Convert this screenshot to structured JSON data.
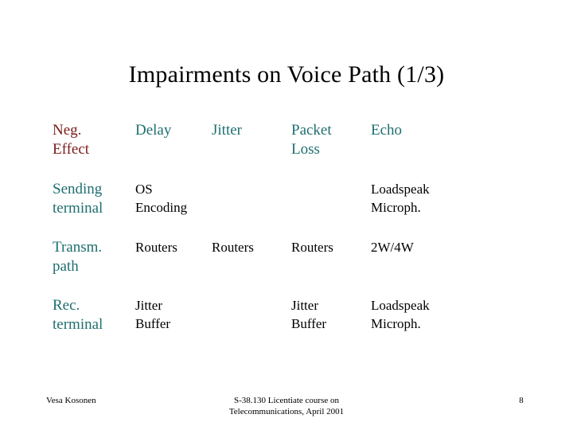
{
  "slide": {
    "title": "Impairments on Voice Path (1/3)",
    "colors": {
      "title": "#000000",
      "effect_label": "#7b1a1a",
      "metric_header": "#1f6f6f",
      "row_label": "#1f6f6f",
      "cell_text": "#000000",
      "background": "#ffffff"
    }
  },
  "table": {
    "headers": [
      {
        "line1": "Neg.",
        "line2": "Effect"
      },
      {
        "line1": "Delay",
        "line2": ""
      },
      {
        "line1": "Jitter",
        "line2": ""
      },
      {
        "line1": "Packet",
        "line2": "Loss"
      },
      {
        "line1": "Echo",
        "line2": ""
      }
    ],
    "rows": [
      {
        "label": {
          "line1": "Sending",
          "line2": "terminal"
        },
        "cells": [
          {
            "line1": "OS",
            "line2": "Encoding"
          },
          {
            "line1": "",
            "line2": ""
          },
          {
            "line1": "",
            "line2": ""
          },
          {
            "line1": "Loadspeak",
            "line2": "Microph."
          }
        ]
      },
      {
        "label": {
          "line1": "Transm.",
          "line2": "path"
        },
        "cells": [
          {
            "line1": "Routers",
            "line2": ""
          },
          {
            "line1": "Routers",
            "line2": ""
          },
          {
            "line1": "Routers",
            "line2": ""
          },
          {
            "line1": "2W/4W",
            "line2": ""
          }
        ]
      },
      {
        "label": {
          "line1": "Rec.",
          "line2": "terminal"
        },
        "cells": [
          {
            "line1": "Jitter",
            "line2": "Buffer"
          },
          {
            "line1": "",
            "line2": ""
          },
          {
            "line1": "Jitter",
            "line2": "Buffer"
          },
          {
            "line1": "Loadspeak",
            "line2": "Microph."
          }
        ]
      }
    ]
  },
  "footer": {
    "author": "Vesa Kosonen",
    "course_line1": "S-38.130 Licentiate course on",
    "course_line2": "Telecommunications, April 2001",
    "page_number": "8"
  }
}
